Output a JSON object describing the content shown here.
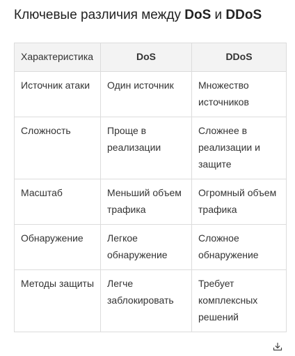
{
  "title": {
    "prefix": "Ключевые различия между ",
    "dos": "DoS",
    "middle": " и ",
    "ddos": "DDoS"
  },
  "table": {
    "headers": [
      "Характеристика",
      "DoS",
      "DDoS"
    ],
    "rows": [
      [
        "Источник атаки",
        "Один источник",
        "Множество источников"
      ],
      [
        "Сложность",
        "Проще в реализации",
        "Сложнее в реализации и защите"
      ],
      [
        "Масштаб",
        "Меньший объем трафика",
        "Огромный объем трафика"
      ],
      [
        "Обнаружение",
        "Легкое обнаружение",
        "Сложное обнаружение"
      ],
      [
        "Методы защиты",
        "Легче заблокировать",
        "Требует комплексных решений"
      ]
    ]
  },
  "icons": {
    "download": "download-icon"
  }
}
